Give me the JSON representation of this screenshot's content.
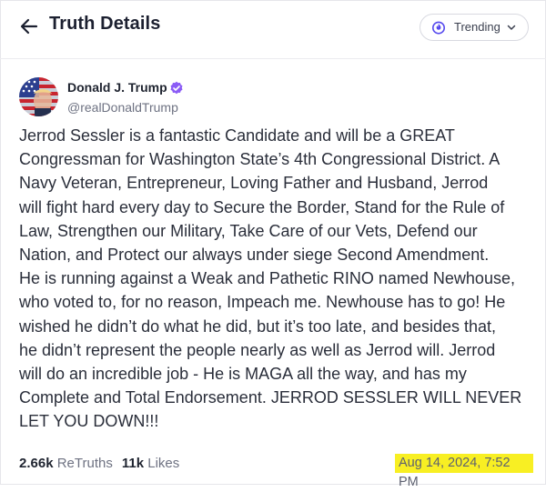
{
  "header": {
    "title": "Truth Details",
    "trending_label": "Trending"
  },
  "author": {
    "name": "Donald J. Trump",
    "handle": "@realDonaldTrump"
  },
  "post": {
    "lines": [
      "Jerrod Sessler is a fantastic Candidate and will be a GREAT",
      "Congressman for Washington State’s 4th Congressional District. A",
      "Navy Veteran, Entrepreneur, Loving Father and Husband, Jerrod",
      "will fight hard every day to Secure the Border, Stand for the Rule of",
      "Law, Strengthen our Military, Take Care of our Vets, Defend our",
      "Nation, and Protect our always under siege Second Amendment.",
      "He is running against a Weak and Pathetic RINO named Newhouse,",
      "who voted to, for no reason, Impeach me. Newhouse has to go! He",
      "wished he didn’t do what he did, but it’s too late, and besides that,",
      "he didn’t represent the people nearly as well as Jerrod will. Jerrod",
      "will do an incredible job - He is MAGA all the way, and has my",
      "Complete and Total Endorsement. JERROD SESSLER WILL NEVER",
      "LET YOU DOWN!!!"
    ]
  },
  "stats": {
    "retruths_count": "2.66k",
    "retruths_label": "ReTruths",
    "likes_count": "11k",
    "likes_label": "Likes"
  },
  "timestamp": "Aug 14, 2024, 7:52 PM",
  "colors": {
    "highlight": "#f8ef23",
    "verified": "#8b5cf6",
    "accent": "#5448ee"
  }
}
